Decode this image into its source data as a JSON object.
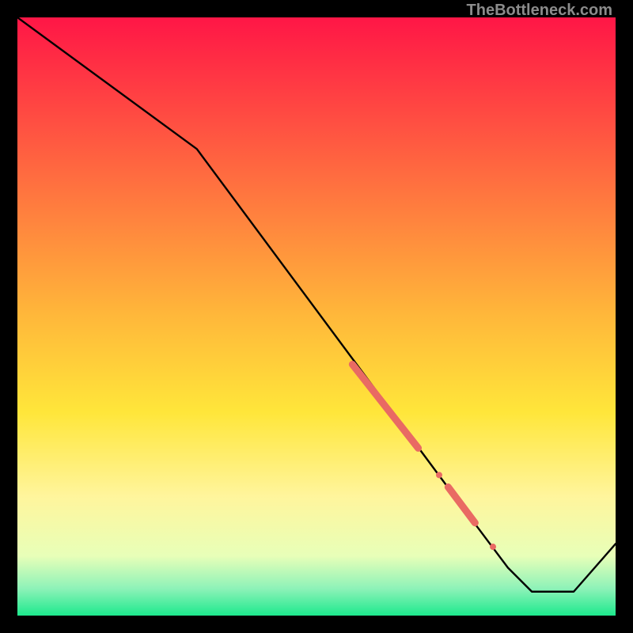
{
  "watermark": "TheBottleneck.com",
  "colors": {
    "bg": "#000000",
    "text": "#8b8b8b",
    "line": "#000000",
    "marker": "#e96a63",
    "grad_top": "#ff1646",
    "grad_mid1": "#ff8a3a",
    "grad_mid2": "#ffe63a",
    "grad_mid3": "#fff59c",
    "grad_bot": "#1de98d"
  },
  "chart_data": {
    "type": "line",
    "title": "",
    "xlabel": "",
    "ylabel": "",
    "xlim": [
      0,
      100
    ],
    "ylim": [
      0,
      100
    ],
    "series": [
      {
        "name": "curve",
        "x": [
          0,
          30,
          76,
          82,
          86,
          93,
          100
        ],
        "y": [
          100,
          78,
          16,
          8,
          4,
          4,
          12
        ]
      }
    ],
    "markers": [
      {
        "name": "thick-segment-1",
        "x_range": [
          56,
          67
        ],
        "y_range": [
          42,
          28
        ],
        "width": 9
      },
      {
        "name": "dot-1",
        "x": 70.5,
        "y": 23.5,
        "r": 4
      },
      {
        "name": "thick-segment-2",
        "x_range": [
          72,
          76.5
        ],
        "y_range": [
          21.5,
          15.5
        ],
        "width": 9
      },
      {
        "name": "dot-2",
        "x": 79.5,
        "y": 11.5,
        "r": 4
      }
    ],
    "gradient_stops": [
      {
        "pct": 0.0,
        "color": "#ff1646"
      },
      {
        "pct": 0.5,
        "color": "#ffb83a"
      },
      {
        "pct": 0.66,
        "color": "#ffe63a"
      },
      {
        "pct": 0.8,
        "color": "#fff59c"
      },
      {
        "pct": 0.9,
        "color": "#e8ffb8"
      },
      {
        "pct": 0.955,
        "color": "#8df2b8"
      },
      {
        "pct": 1.0,
        "color": "#1de98d"
      }
    ]
  }
}
